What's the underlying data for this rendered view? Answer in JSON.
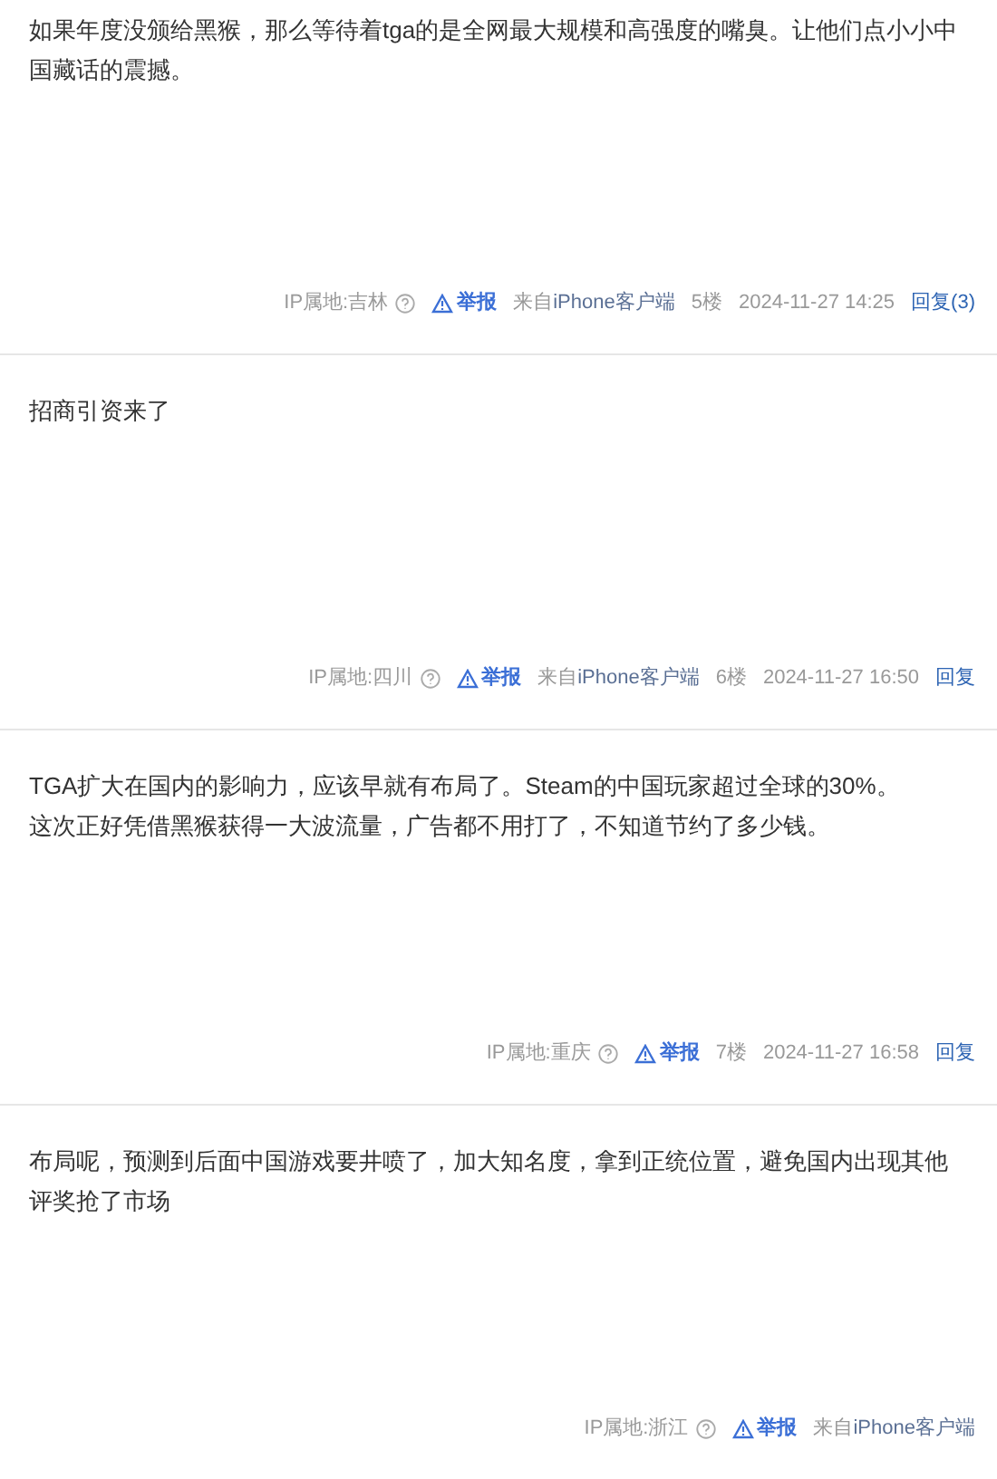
{
  "posts": [
    {
      "lines": [
        "如果年度没颁给黑猴，那么等待着tga的是全网最大规模和高强度的嘴臭。让他们点小小中国藏话的震撼。"
      ],
      "ip": "IP属地:吉林",
      "report": "举报",
      "source": "来自",
      "client": "iPhone客户端",
      "floor": "5楼",
      "time": "2024-11-27 14:25",
      "reply": "回复(3)"
    },
    {
      "lines": [
        "招商引资来了"
      ],
      "ip": "IP属地:四川",
      "report": "举报",
      "source": "来自",
      "client": "iPhone客户端",
      "floor": "6楼",
      "time": "2024-11-27 16:50",
      "reply": "回复"
    },
    {
      "lines": [
        "TGA扩大在国内的影响力，应该早就有布局了。Steam的中国玩家超过全球的30%。",
        "这次正好凭借黑猴获得一大波流量，广告都不用打了，不知道节约了多少钱。"
      ],
      "ip": "IP属地:重庆",
      "report": "举报",
      "floor": "7楼",
      "time": "2024-11-27 16:58",
      "reply": "回复"
    },
    {
      "lines": [
        "布局呢，预测到后面中国游戏要井喷了，加大知名度，拿到正统位置，避免国内出现其他评奖抢了市场"
      ],
      "ip": "IP属地:浙江",
      "report": "举报",
      "source": "来自",
      "client": "iPhone客户端"
    }
  ]
}
